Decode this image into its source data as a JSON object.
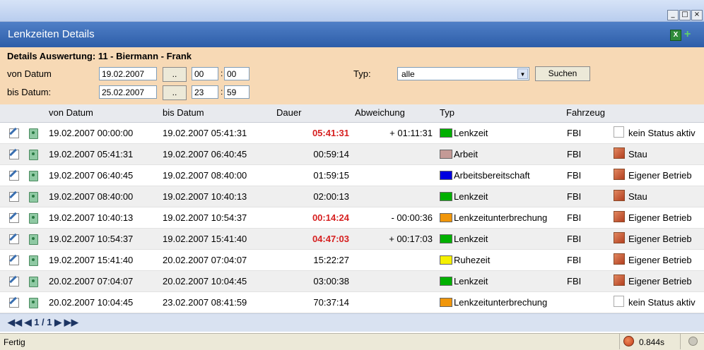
{
  "window": {
    "minimize": "_",
    "maximize": "□",
    "close": "×"
  },
  "header": {
    "title": "Lenkzeiten Details",
    "excel_icon_label": "X",
    "add_icon_label": "+"
  },
  "filter": {
    "title": "Details Auswertung: 11 - Biermann - Frank",
    "from_label": "von Datum",
    "to_label": "bis Datum:",
    "from_date": "19.02.2007",
    "to_date": "25.02.2007",
    "picker_label": "..",
    "from_hour": "00",
    "from_min": "00",
    "to_hour": "23",
    "to_min": "59",
    "colon": ":",
    "type_label": "Typ:",
    "type_value": "alle",
    "search_label": "Suchen"
  },
  "columns": {
    "from": "von Datum",
    "to": "bis Datum",
    "duration": "Dauer",
    "deviation": "Abweichung",
    "type": "Typ",
    "vehicle": "Fahrzeug"
  },
  "rows": [
    {
      "from": "19.02.2007 00:00:00",
      "to": "19.02.2007 05:41:31",
      "duration": "05:41:31",
      "duration_red": true,
      "deviation": "+ 01:11:31",
      "type": "Lenkzeit",
      "color": "#00b000",
      "vehicle": "FBI",
      "status": "kein Status aktiv",
      "status_icon": "empty-box"
    },
    {
      "from": "19.02.2007 05:41:31",
      "to": "19.02.2007 06:40:45",
      "duration": "00:59:14",
      "duration_red": false,
      "deviation": "",
      "type": "Arbeit",
      "color": "#c49a96",
      "vehicle": "FBI",
      "status": "Stau",
      "status_icon": "stau-icon"
    },
    {
      "from": "19.02.2007 06:40:45",
      "to": "19.02.2007 08:40:00",
      "duration": "01:59:15",
      "duration_red": false,
      "deviation": "",
      "type": "Arbeitsbereitschaft",
      "color": "#0000e0",
      "vehicle": "FBI",
      "status": "Eigener Betrieb",
      "status_icon": "betrieb-icon"
    },
    {
      "from": "19.02.2007 08:40:00",
      "to": "19.02.2007 10:40:13",
      "duration": "02:00:13",
      "duration_red": false,
      "deviation": "",
      "type": "Lenkzeit",
      "color": "#00b000",
      "vehicle": "FBI",
      "status": "Stau",
      "status_icon": "stau-icon"
    },
    {
      "from": "19.02.2007 10:40:13",
      "to": "19.02.2007 10:54:37",
      "duration": "00:14:24",
      "duration_red": true,
      "deviation": "- 00:00:36",
      "type": "Lenkzeitunterbrechung",
      "color": "#f0960a",
      "vehicle": "FBI",
      "status": "Eigener Betrieb",
      "status_icon": "betrieb-icon"
    },
    {
      "from": "19.02.2007 10:54:37",
      "to": "19.02.2007 15:41:40",
      "duration": "04:47:03",
      "duration_red": true,
      "deviation": "+ 00:17:03",
      "type": "Lenkzeit",
      "color": "#00b000",
      "vehicle": "FBI",
      "status": "Eigener Betrieb",
      "status_icon": "betrieb-icon"
    },
    {
      "from": "19.02.2007 15:41:40",
      "to": "20.02.2007 07:04:07",
      "duration": "15:22:27",
      "duration_red": false,
      "deviation": "",
      "type": "Ruhezeit",
      "color": "#f5f000",
      "vehicle": "FBI",
      "status": "Eigener Betrieb",
      "status_icon": "betrieb-icon"
    },
    {
      "from": "20.02.2007 07:04:07",
      "to": "20.02.2007 10:04:45",
      "duration": "03:00:38",
      "duration_red": false,
      "deviation": "",
      "type": "Lenkzeit",
      "color": "#00b000",
      "vehicle": "FBI",
      "status": "Eigener Betrieb",
      "status_icon": "betrieb-icon"
    },
    {
      "from": "20.02.2007 10:04:45",
      "to": "23.02.2007 08:41:59",
      "duration": "70:37:14",
      "duration_red": false,
      "deviation": "",
      "type": "Lenkzeitunterbrechung",
      "color": "#f0960a",
      "vehicle": "",
      "status": "kein Status aktiv",
      "status_icon": "empty-box"
    }
  ],
  "pager": {
    "text": "◀◀ ◀ 1 / 1 ▶ ▶▶"
  },
  "statusbar": {
    "text": "Fertig",
    "time": "0.844s"
  }
}
